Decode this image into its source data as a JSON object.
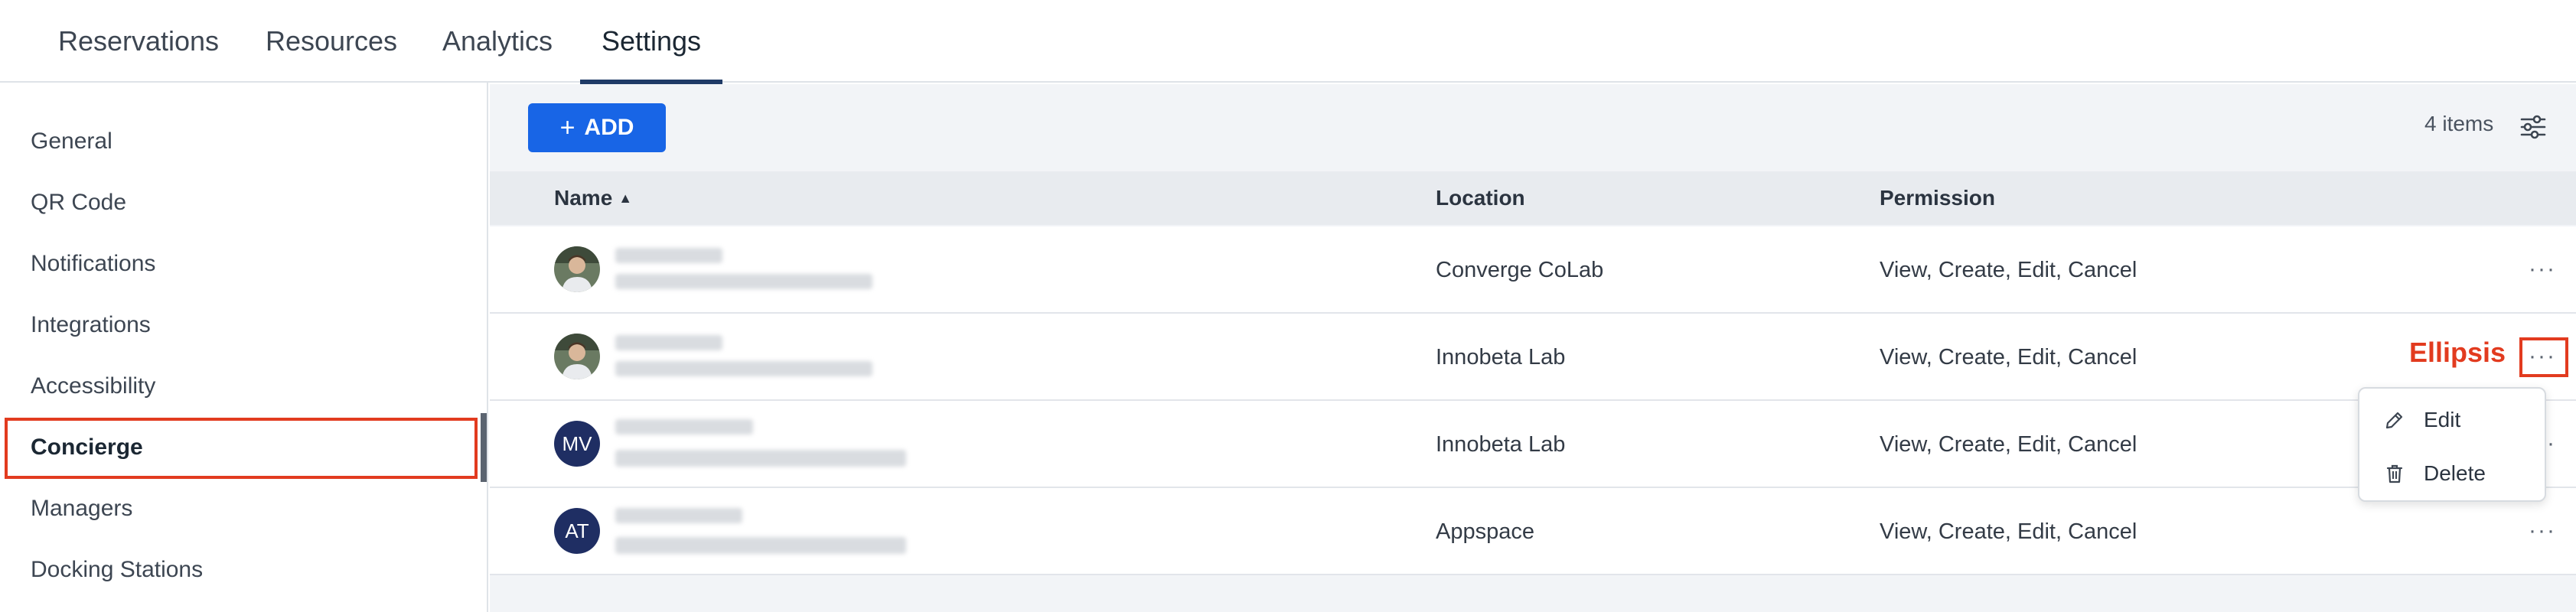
{
  "topnav": {
    "tabs": [
      {
        "label": "Reservations"
      },
      {
        "label": "Resources"
      },
      {
        "label": "Analytics"
      },
      {
        "label": "Settings",
        "active": true
      }
    ]
  },
  "sidebar": {
    "items": [
      {
        "label": "General"
      },
      {
        "label": "QR Code"
      },
      {
        "label": "Notifications"
      },
      {
        "label": "Integrations"
      },
      {
        "label": "Accessibility"
      },
      {
        "label": "Concierge",
        "active": true
      },
      {
        "label": "Managers"
      },
      {
        "label": "Docking Stations"
      }
    ]
  },
  "toolbar": {
    "add_label": "ADD",
    "add_icon": "+",
    "item_count": "4 items",
    "settings_icon": "sliders-icon"
  },
  "table": {
    "columns": {
      "name": "Name",
      "location": "Location",
      "permission": "Permission"
    },
    "sort": {
      "column": "name",
      "direction": "ascending"
    },
    "rows": [
      {
        "avatar": "photo",
        "location": "Converge CoLab",
        "permission": "View, Create, Edit, Cancel"
      },
      {
        "avatar": "photo",
        "location": "Innobeta Lab",
        "permission": "View, Create, Edit, Cancel"
      },
      {
        "avatar": "MV",
        "location": "Innobeta Lab",
        "permission": "View, Create, Edit, Cancel"
      },
      {
        "avatar": "AT",
        "location": "Appspace",
        "permission": "View, Create, Edit, Cancel"
      }
    ],
    "row_menu_icon": "···"
  },
  "annotation": {
    "label": "Ellipsis",
    "color": "#e23b1f"
  },
  "menu": {
    "items": [
      {
        "label": "Edit",
        "icon": "pencil-icon"
      },
      {
        "label": "Delete",
        "icon": "trash-icon"
      }
    ]
  },
  "colors": {
    "accent": "#1865e6",
    "nav_underline": "#1f3a66",
    "avatar_initials_bg": "#1f2e63",
    "highlight": "#e23b1f"
  }
}
